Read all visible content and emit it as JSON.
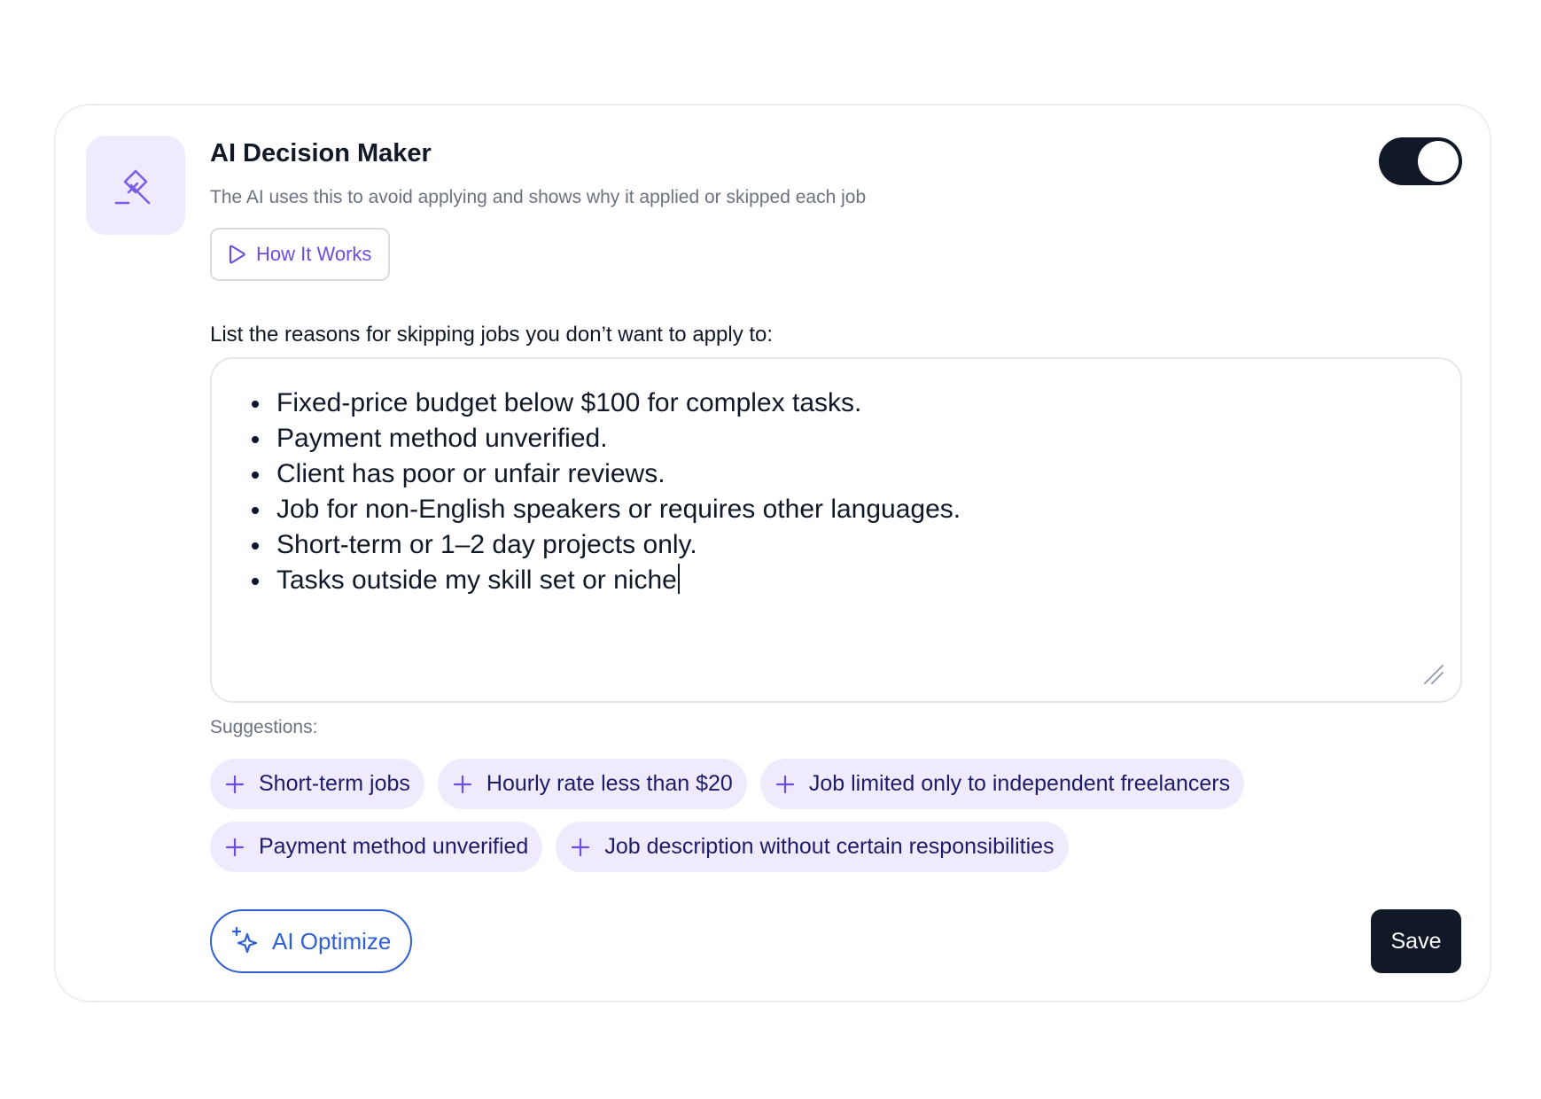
{
  "header": {
    "title": "AI Decision Maker",
    "subtitle": "The AI uses this to avoid applying and shows why it applied or skipped each job",
    "icon": "eraser-icon",
    "toggle_enabled": true,
    "how_it_works_label": "How It Works"
  },
  "reasons": {
    "label": "List the reasons for skipping jobs you don’t want to apply to:",
    "items": [
      "Fixed-price budget below $100 for complex tasks.",
      "Payment method unverified.",
      "Client has poor or unfair reviews.",
      "Job for non-English speakers or requires other languages.",
      "Short-term or 1–2 day projects only.",
      "Tasks outside my skill set or niche"
    ]
  },
  "suggestions": {
    "label": "Suggestions:",
    "items": [
      "Short-term jobs",
      "Hourly rate less than $20",
      "Job limited only to independent freelancers",
      "Payment method unverified",
      "Job description without certain responsibilities"
    ]
  },
  "actions": {
    "optimize_label": "AI Optimize",
    "save_label": "Save"
  },
  "colors": {
    "accent_purple": "#6d4de6",
    "chip_bg": "#efebfd",
    "optimize_blue": "#2f5fd3",
    "dark": "#111827"
  }
}
